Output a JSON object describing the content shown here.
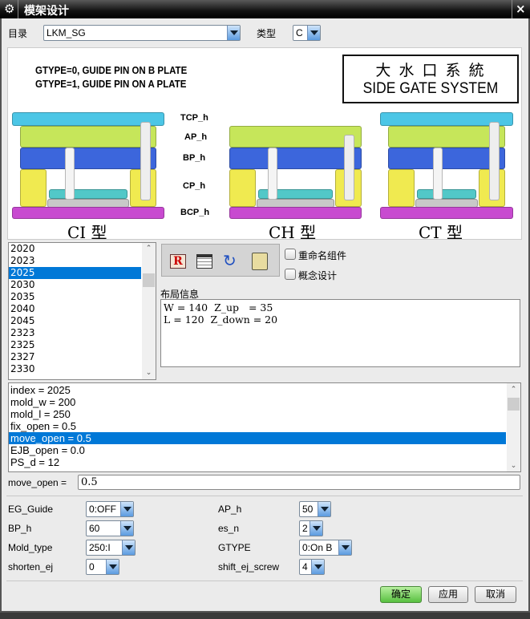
{
  "window": {
    "title": "模架设计",
    "icon": "gear-icon",
    "close": "×"
  },
  "catalog": {
    "label": "目录",
    "value": "LKM_SG"
  },
  "type": {
    "label": "类型",
    "value": "C"
  },
  "image": {
    "note1": "GTYPE=0, GUIDE PIN ON B PLATE",
    "note2": "GTYPE=1, GUIDE PIN ON A PLATE",
    "box_cn": "大 水 口 系 統",
    "box_en": "SIDE GATE SYSTEM",
    "plate_labels": [
      "TCP_h",
      "AP_h",
      "BP_h",
      "CP_h",
      "BCP_h"
    ],
    "captions": [
      "CI 型",
      "CH 型",
      "CT 型"
    ],
    "colors": {
      "tcp": "#4cc6e6",
      "ap": "#c6e65a",
      "bp": "#3c66dc",
      "cp": "#f0ea50",
      "ejector": "#52c8c8",
      "ejgrey": "#c8c8c8",
      "bcp": "#c84ad0"
    }
  },
  "size_list": {
    "items": [
      "2020",
      "2023",
      "2025",
      "2030",
      "2035",
      "2040",
      "2045",
      "2323",
      "2325",
      "2327",
      "2330"
    ],
    "selected": "2025"
  },
  "toolbar": {
    "icons": [
      "report-icon",
      "table-icon",
      "rotate-icon",
      "component-icon"
    ]
  },
  "options": {
    "rename": "重命名组件",
    "concept": "概念设计"
  },
  "layout_info": {
    "label": "布局信息",
    "lines": [
      "W = 140  Z_up   = 35",
      "L = 120  Z_down = 20"
    ]
  },
  "params": {
    "items": [
      "index = 2025",
      "mold_w = 200",
      "mold_l = 250",
      "fix_open = 0.5",
      "move_open = 0.5",
      "EJB_open = 0.0",
      "PS_d = 12"
    ],
    "selected": "move_open = 0.5"
  },
  "edit": {
    "label": "move_open =",
    "value": "0.5"
  },
  "fields": [
    {
      "label": "EG_Guide",
      "value": "0:OFF"
    },
    {
      "label": "AP_h",
      "value": "50"
    },
    {
      "label": "BP_h",
      "value": "60"
    },
    {
      "label": "es_n",
      "value": "2"
    },
    {
      "label": "Mold_type",
      "value": "250:I"
    },
    {
      "label": "GTYPE",
      "value": "0:On B"
    },
    {
      "label": "shorten_ej",
      "value": "0"
    },
    {
      "label": "shift_ej_screw",
      "value": "4"
    }
  ],
  "buttons": {
    "ok": "确定",
    "apply": "应用",
    "cancel": "取消"
  }
}
